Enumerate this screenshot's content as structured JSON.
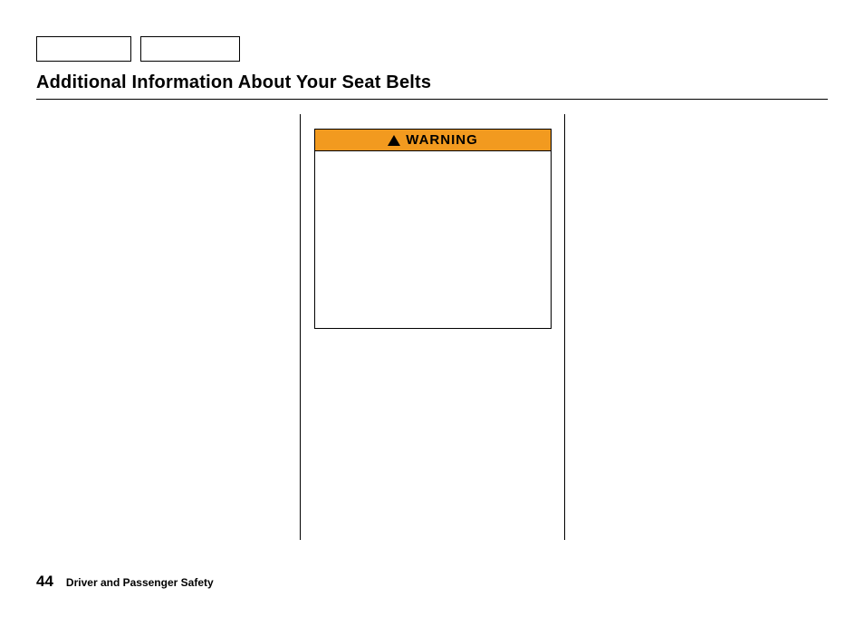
{
  "page_title": "Additional Information About Your Seat Belts",
  "warning": {
    "label": "WARNING"
  },
  "footer": {
    "page_number": "44",
    "section": "Driver and Passenger Safety"
  }
}
